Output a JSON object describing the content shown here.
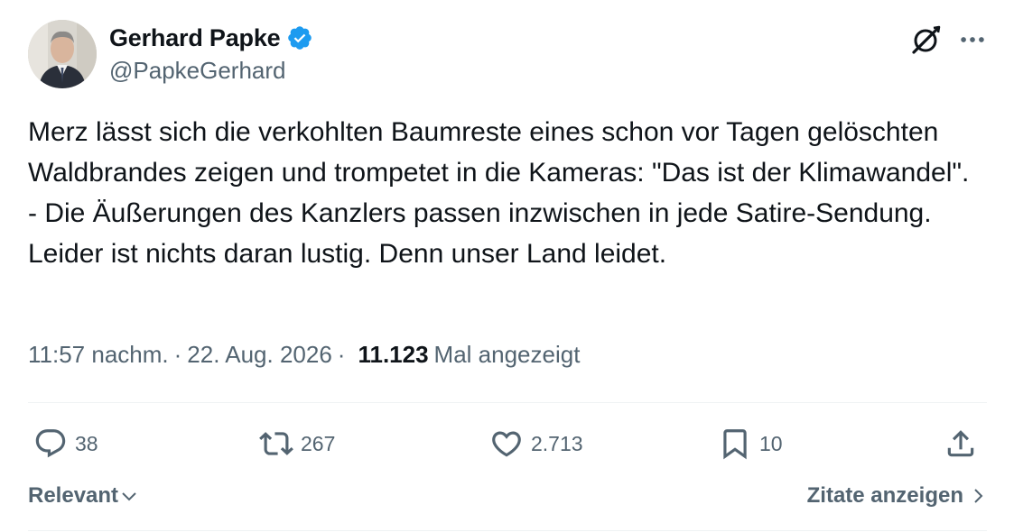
{
  "author": {
    "name": "Gerhard Papke",
    "handle": "@PapkeGerhard",
    "verified": true
  },
  "tweet": {
    "text": "Merz lässt sich die verkohlten Baumreste eines schon vor Tagen gelöschten Waldbrandes zeigen und trompetet in die Kameras: \"Das ist der Klimawandel\". - Die Äußerungen des Kanzlers passen inzwischen in jede Satire-Sendung. Leider ist nichts daran lustig. Denn unser Land leidet.",
    "time": "11:57 nachm.",
    "date": "22. Aug. 2026",
    "separator": "·",
    "views_count": "11.123",
    "views_label": "Mal angezeigt"
  },
  "actions": {
    "replies": "38",
    "reposts": "267",
    "likes": "2.713",
    "bookmarks": "10"
  },
  "footer": {
    "sort_label": "Relevant",
    "quotes_label": "Zitate anzeigen"
  },
  "colors": {
    "text_primary": "#0f1419",
    "text_secondary": "#536471",
    "verified_blue": "#1d9bf0",
    "divider": "#eff3f4"
  },
  "icons": {
    "verified": "verified-badge-icon",
    "grok": "grok-icon",
    "more": "more-icon",
    "reply": "reply-icon",
    "repost": "repost-icon",
    "like": "like-icon",
    "bookmark": "bookmark-icon",
    "share": "share-icon",
    "sort": "chevron-down-icon",
    "quotes": "chevron-right-icon"
  }
}
